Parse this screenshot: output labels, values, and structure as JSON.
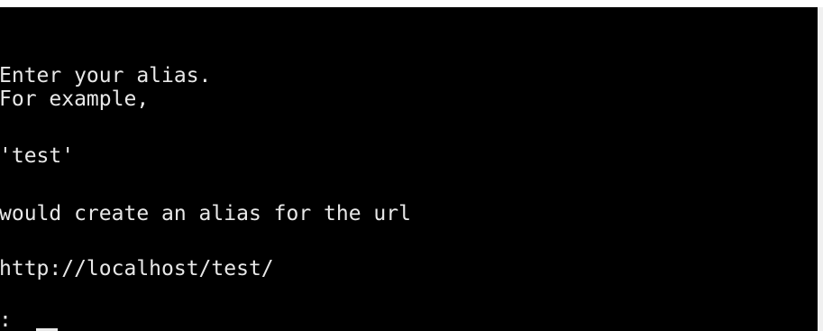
{
  "console": {
    "background": "#000000",
    "foreground": "#e8e8e8",
    "lines": [
      "Enter your alias.",
      "For example,",
      "'test'",
      "would create an alias for the url",
      "http://localhost/test/",
      ": "
    ]
  }
}
